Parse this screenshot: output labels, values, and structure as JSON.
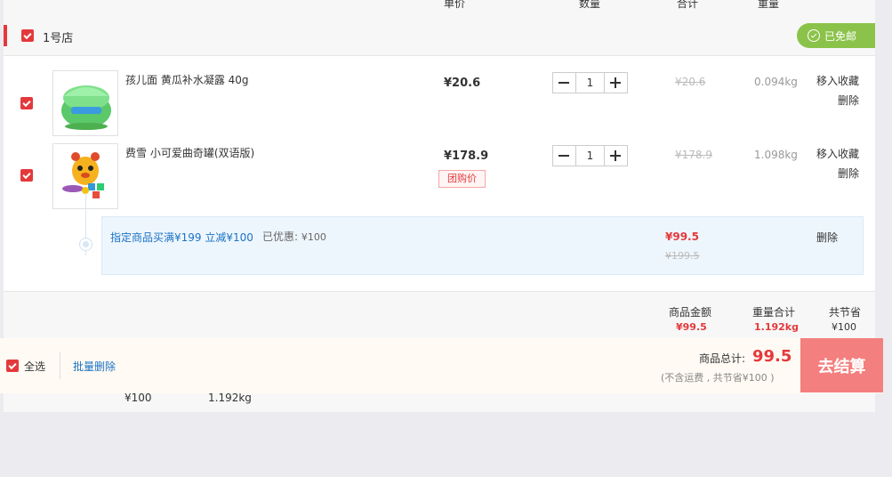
{
  "columns": {
    "unit_price": "单价",
    "quantity": "数量",
    "subtotal": "合计",
    "weight": "重量"
  },
  "shop": {
    "name": "1号店",
    "free_shipping": "已免邮"
  },
  "items": [
    {
      "title": "孩儿面 黄瓜补水凝露 40g",
      "price": "¥20.6",
      "quantity": "1",
      "subtotal": "¥20.6",
      "weight": "0.094kg",
      "fav": "移入收藏",
      "del": "删除"
    },
    {
      "title": "费雪 小可爱曲奇罐(双语版)",
      "price": "¥178.9",
      "badge": "团购价",
      "quantity": "1",
      "subtotal": "¥178.9",
      "weight": "1.098kg",
      "fav": "移入收藏",
      "del": "删除"
    }
  ],
  "promo": {
    "link": "指定商品买满¥199 立减¥100",
    "saved_label": "已优惠:",
    "saved_value": "¥100",
    "price": "¥99.5",
    "old_price": "¥199.5",
    "del": "删除"
  },
  "summary": {
    "goods_label": "商品金额",
    "goods_value": "¥99.5",
    "weight_label": "重量合计",
    "weight_value": "1.192kg",
    "save_label": "共节省",
    "save_value": "¥100"
  },
  "footer": {
    "select_all": "全选",
    "batch_delete": "批量删除",
    "total_label": "商品总计:",
    "total_value": "99.5",
    "note": "(不含运费 , 共节省¥100 )",
    "checkout": "去结算"
  },
  "ghost": {
    "save": "¥100",
    "weight": "1.192kg"
  },
  "colors": {
    "accent": "#e4393c",
    "link": "#1a73c5",
    "free_ship": "#8bc34a",
    "checkout": "#f47f7f"
  }
}
